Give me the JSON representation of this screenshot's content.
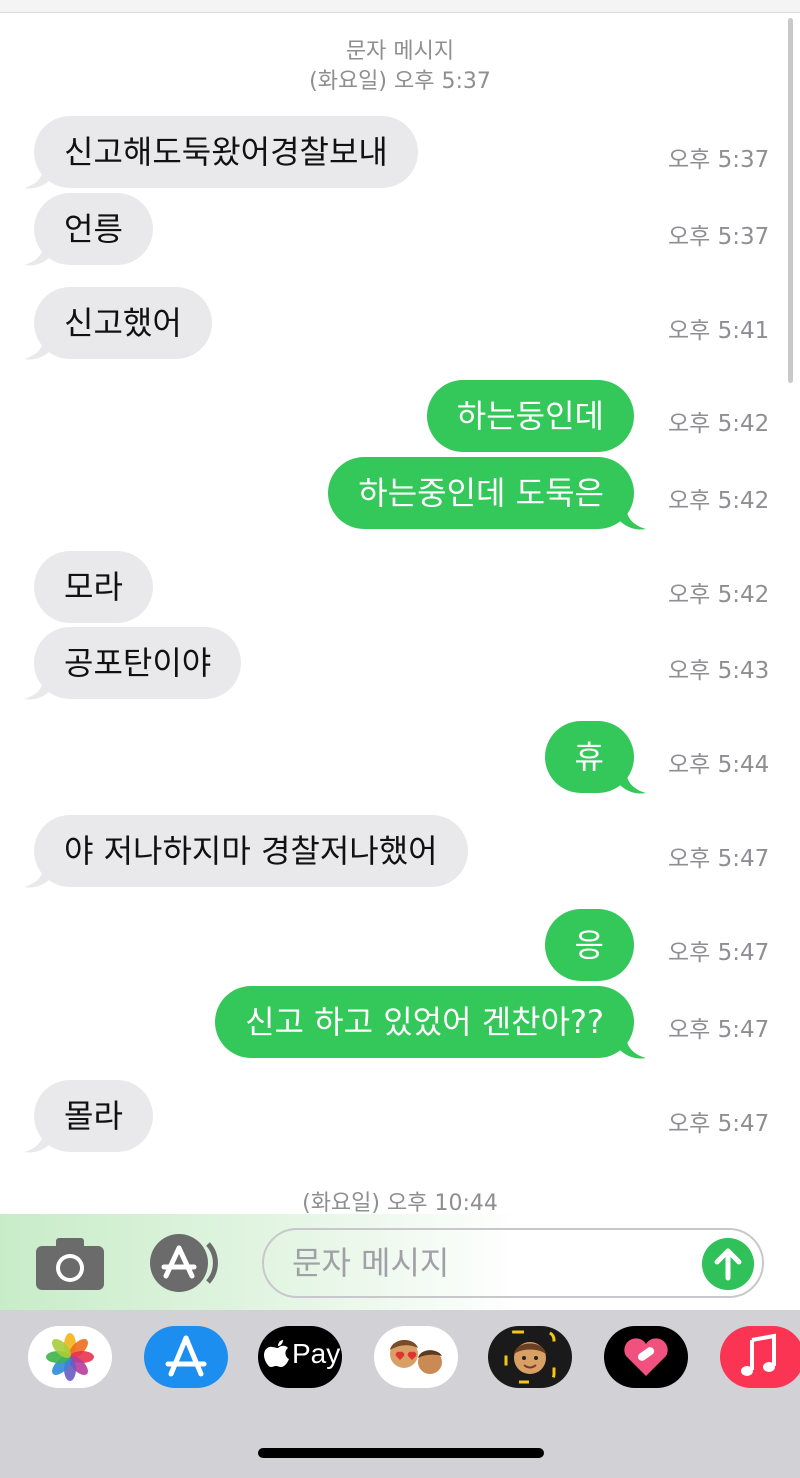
{
  "conversation": {
    "header1_line1": "문자 메시지",
    "header1_line2": "(화요일) 오후 5:37",
    "header2": "(화요일) 오후 10:44"
  },
  "messages": [
    {
      "dir": "in",
      "text": "신고해도둑왔어경찰보내",
      "time": "오후 5:37"
    },
    {
      "dir": "in",
      "text": "언릉",
      "time": "오후 5:37"
    },
    {
      "dir": "in",
      "text": "신고했어",
      "time": "오후 5:41"
    },
    {
      "dir": "out",
      "text": "하는둥인데",
      "time": "오후 5:42"
    },
    {
      "dir": "out",
      "text": "하는중인데 도둑은",
      "time": "오후 5:42"
    },
    {
      "dir": "in",
      "text": "모라",
      "time": "오후 5:42"
    },
    {
      "dir": "in",
      "text": "공포탄이야",
      "time": "오후 5:43"
    },
    {
      "dir": "out",
      "text": "휴",
      "time": "오후 5:44"
    },
    {
      "dir": "in",
      "text": "야 저나하지마 경찰저나했어",
      "time": "오후 5:47"
    },
    {
      "dir": "out",
      "text": "응",
      "time": "오후 5:47"
    },
    {
      "dir": "out",
      "text": "신고 하고 있었어 겐찬아??",
      "time": "오후 5:47"
    },
    {
      "dir": "in",
      "text": "몰라",
      "time": "오후 5:47"
    }
  ],
  "composer": {
    "placeholder": "문자 메시지",
    "camera_icon": "camera-icon",
    "apps_icon": "app-store-icon",
    "send_icon": "arrow-up-icon"
  },
  "dock": {
    "applepay_label": "Pay",
    "apps": [
      "photos-icon",
      "app-store-icon",
      "apple-pay-icon",
      "animoji-stickers-icon",
      "memoji-icon",
      "digital-touch-icon",
      "music-icon"
    ]
  },
  "colors": {
    "incoming_bubble": "#e9e9eb",
    "outgoing_bubble": "#34c759",
    "timestamp": "#8e8e93"
  }
}
